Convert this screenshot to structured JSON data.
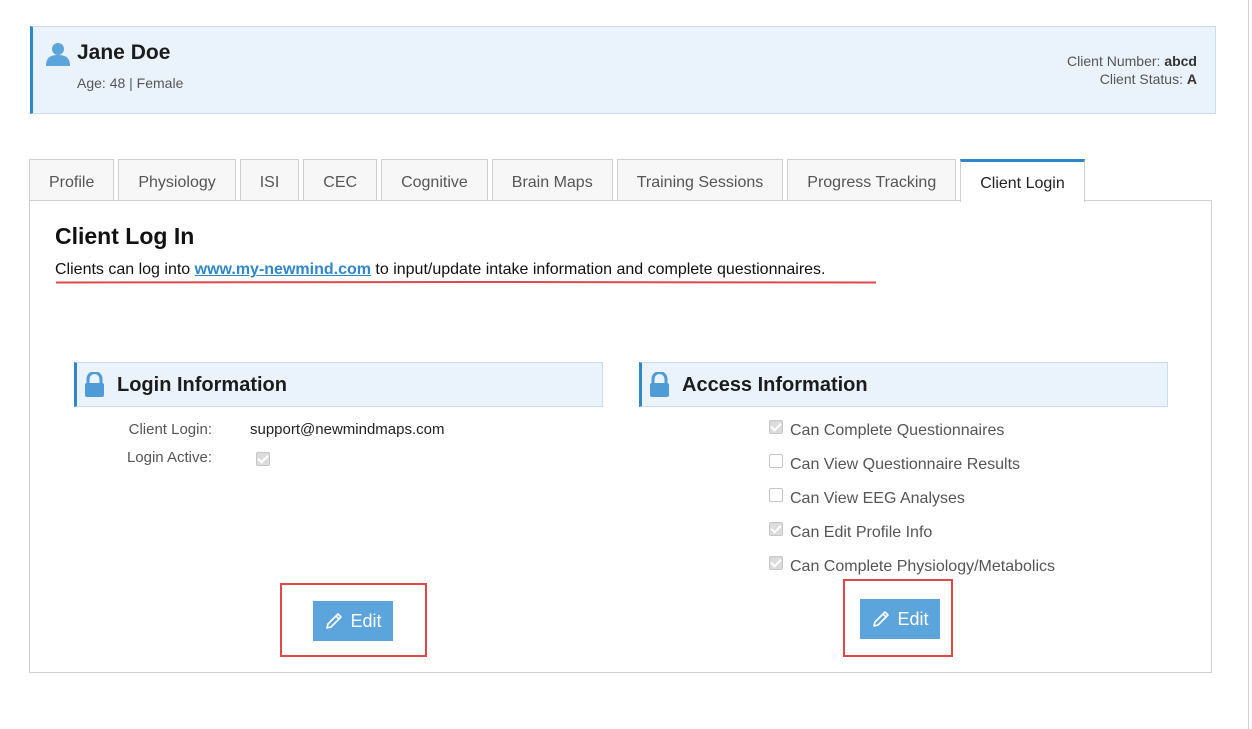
{
  "client": {
    "name": "Jane Doe",
    "age_gender": "Age: 48 | Female",
    "number_label": "Client Number:",
    "number_value": "abcd",
    "status_label": "Client Status:",
    "status_value": "A"
  },
  "tabs": [
    {
      "label": "Profile",
      "active": false
    },
    {
      "label": "Physiology",
      "active": false
    },
    {
      "label": "ISI",
      "active": false
    },
    {
      "label": "CEC",
      "active": false
    },
    {
      "label": "Cognitive",
      "active": false
    },
    {
      "label": "Brain Maps",
      "active": false
    },
    {
      "label": "Training Sessions",
      "active": false
    },
    {
      "label": "Progress Tracking",
      "active": false
    },
    {
      "label": "Client Login",
      "active": true
    }
  ],
  "panel": {
    "title": "Client Log In",
    "desc_before": "Clients can log into ",
    "desc_link": "www.my-newmind.com",
    "desc_after": " to input/update intake information and complete questionnaires."
  },
  "login_info": {
    "title": "Login Information",
    "client_login_label": "Client Login:",
    "client_login_value": "support@newmindmaps.com",
    "login_active_label": "Login Active:",
    "login_active_checked": true,
    "edit_label": "Edit"
  },
  "access_info": {
    "title": "Access Information",
    "items": [
      {
        "label": "Can Complete Questionnaires",
        "checked": true
      },
      {
        "label": "Can View Questionnaire Results",
        "checked": false
      },
      {
        "label": "Can View EEG Analyses",
        "checked": false
      },
      {
        "label": "Can Edit Profile Info",
        "checked": true
      },
      {
        "label": "Can Complete Physiology/Metabolics",
        "checked": true
      }
    ],
    "edit_label": "Edit"
  },
  "colors": {
    "accent": "#2f86c8",
    "button": "#5ba4dc",
    "highlight_red": "#e04848",
    "header_bg": "#eaf3fb"
  },
  "icons": {
    "user": "user-icon",
    "lock": "lock-icon",
    "pencil": "pencil-icon"
  }
}
